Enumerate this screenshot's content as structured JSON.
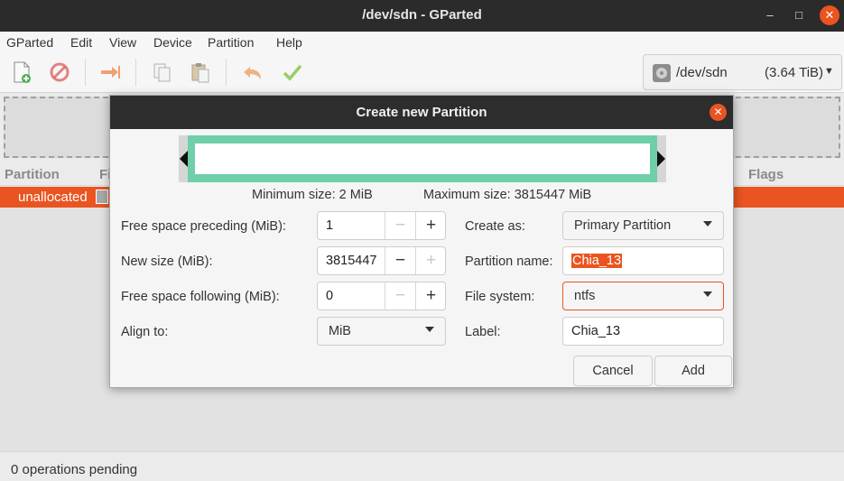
{
  "window": {
    "title": "/dev/sdn - GParted",
    "controls": {
      "minimize": "–",
      "maximize": "□",
      "close": "✕"
    }
  },
  "menubar": {
    "items": [
      "GParted",
      "Edit",
      "View",
      "Device",
      "Partition",
      "Help"
    ]
  },
  "toolbar": {
    "buttons": [
      "new-partition-icon",
      "delete-icon",
      "resize-move-icon",
      "copy-icon",
      "paste-icon",
      "undo-icon",
      "apply-icon"
    ],
    "device": {
      "name": "/dev/sdn",
      "size": "(3.64 TiB)",
      "icon": "disk-icon"
    }
  },
  "partition_list": {
    "columns": [
      "Partition",
      "Fi",
      "Flags"
    ],
    "rows": [
      {
        "name": "unallocated"
      }
    ]
  },
  "status": {
    "text": "0 operations pending"
  },
  "dialog": {
    "title": "Create new Partition",
    "min_size": "Minimum size: 2 MiB",
    "max_size": "Maximum size: 3815447 MiB",
    "fields": {
      "preceding": {
        "label": "Free space preceding (MiB):",
        "value": "1"
      },
      "new_size": {
        "label": "New size (MiB):",
        "value": "3815447"
      },
      "following": {
        "label": "Free space following (MiB):",
        "value": "0"
      },
      "align": {
        "label": "Align to:",
        "value": "MiB"
      },
      "create_as": {
        "label": "Create as:",
        "value": "Primary Partition"
      },
      "partition_name": {
        "label": "Partition name:",
        "value": "Chia_13"
      },
      "file_system": {
        "label": "File system:",
        "value": "ntfs"
      },
      "fs_label": {
        "label": "Label:",
        "value": "Chia_13"
      }
    },
    "spin_symbols": {
      "minus": "−",
      "plus": "+"
    },
    "buttons": {
      "cancel": "Cancel",
      "add": "Add"
    }
  },
  "colors": {
    "accent": "#e95420",
    "partition_fill": "#6ecfa8",
    "titlebar": "#2b2b2b"
  }
}
